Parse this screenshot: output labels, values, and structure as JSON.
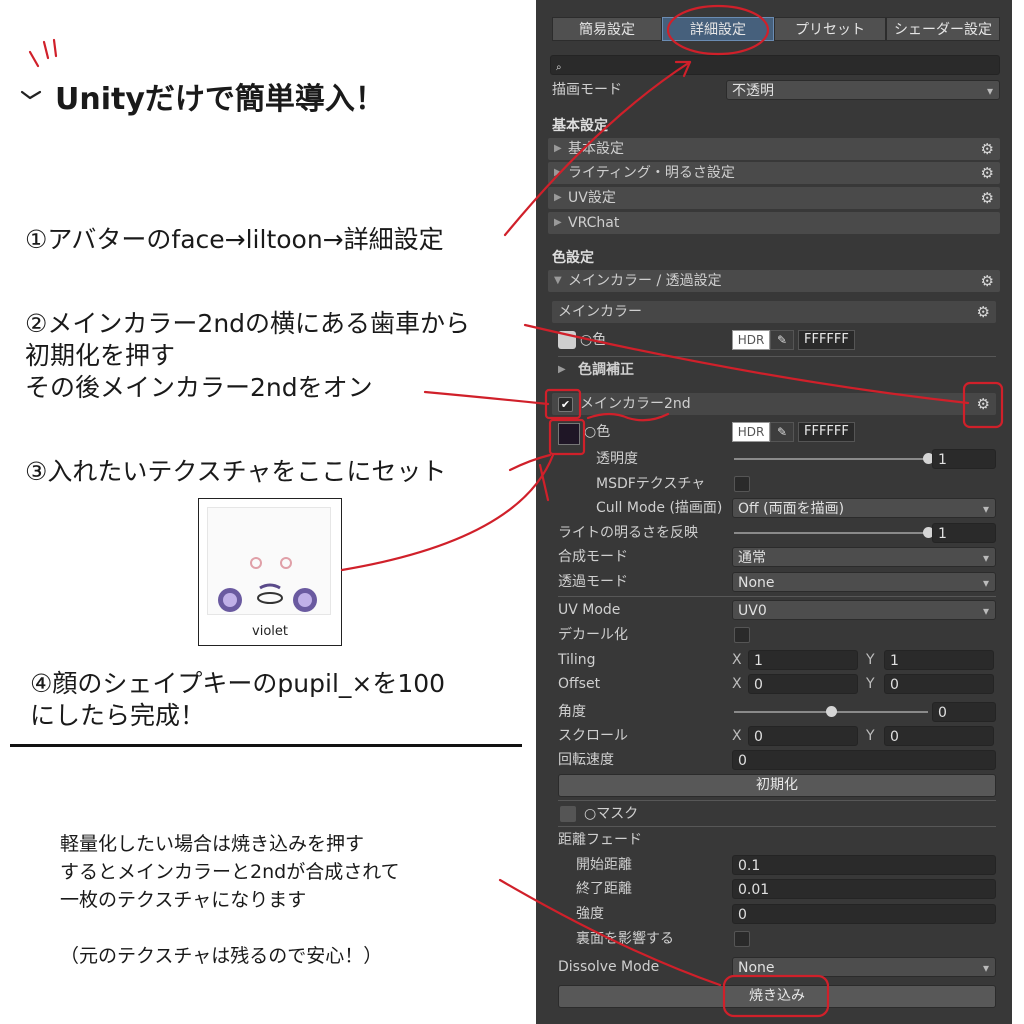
{
  "tutorial": {
    "title": "Unityだけで簡単導入！",
    "step1": "①アバターのface→liltoon→詳細設定",
    "step2": "②メインカラー2ndの横にある歯車から\n初期化を押す\nその後メインカラー2ndをオン",
    "step3": "③入れたいテクスチャをここにセット",
    "step4": "④顔のシェイプキーのpupil_×を100\nにしたら完成！",
    "tip": "軽量化したい場合は焼き込みを押す\nするとメインカラーと2ndが合成されて\n一枚のテクスチャになります\n\n（元のテクスチャは残るので安心！）",
    "texture_label": "violet"
  },
  "panel": {
    "tabs": [
      "簡易設定",
      "詳細設定",
      "プリセット",
      "シェーダー設定"
    ],
    "active_tab": "詳細設定",
    "render_mode_label": "描画モード",
    "render_mode_value": "不透明",
    "basic_section": "基本設定",
    "folds": [
      "基本設定",
      "ライティング・明るさ設定",
      "UV設定",
      "VRChat"
    ],
    "color_section": "色設定",
    "main_fold": "メインカラー / 透過設定",
    "main_color_header": "メインカラー",
    "color_label": "○色",
    "hdr": "HDR",
    "hex_main": "FFFFFF",
    "color_correction": "色調補正",
    "main2_header": "メインカラー2nd",
    "hex_main2": "FFFFFF",
    "opacity_label": "透明度",
    "opacity_value": "1",
    "opacity_level": 1.0,
    "msdf_label": "MSDFテクスチャ",
    "cull_label": "Cull Mode (描画面)",
    "cull_value": "Off (両面を描画)",
    "light_label": "ライトの明るさを反映",
    "light_value": "1",
    "light_level": 1.0,
    "blend_label": "合成モード",
    "blend_value": "通常",
    "alpha_label": "透過モード",
    "alpha_value": "None",
    "uvmode_label": "UV Mode",
    "uvmode_value": "UV0",
    "decal_label": "デカール化",
    "tiling_label": "Tiling",
    "tiling_x": "1",
    "tiling_y": "1",
    "offset_label": "Offset",
    "offset_x": "0",
    "offset_y": "0",
    "angle_label": "角度",
    "angle_value": "0",
    "angle_level": 0.5,
    "scroll_label": "スクロール",
    "scroll_x": "0",
    "scroll_y": "0",
    "rotspeed_label": "回転速度",
    "rotspeed_value": "0",
    "reset_button": "初期化",
    "mask_label": "○マスク",
    "fade_label": "距離フェード",
    "fade_start_label": "開始距離",
    "fade_start_value": "0.1",
    "fade_end_label": "終了距離",
    "fade_end_value": "0.01",
    "strength_label": "強度",
    "strength_value": "0",
    "backface_label": "裏面を影響する",
    "dissolve_label": "Dissolve Mode",
    "dissolve_value": "None",
    "bake_button": "焼き込み",
    "axis_x": "X",
    "axis_y": "Y"
  },
  "colors": {
    "annotation": "#d0202a",
    "active_tab": "#46607c",
    "panel_bg": "#383838"
  }
}
